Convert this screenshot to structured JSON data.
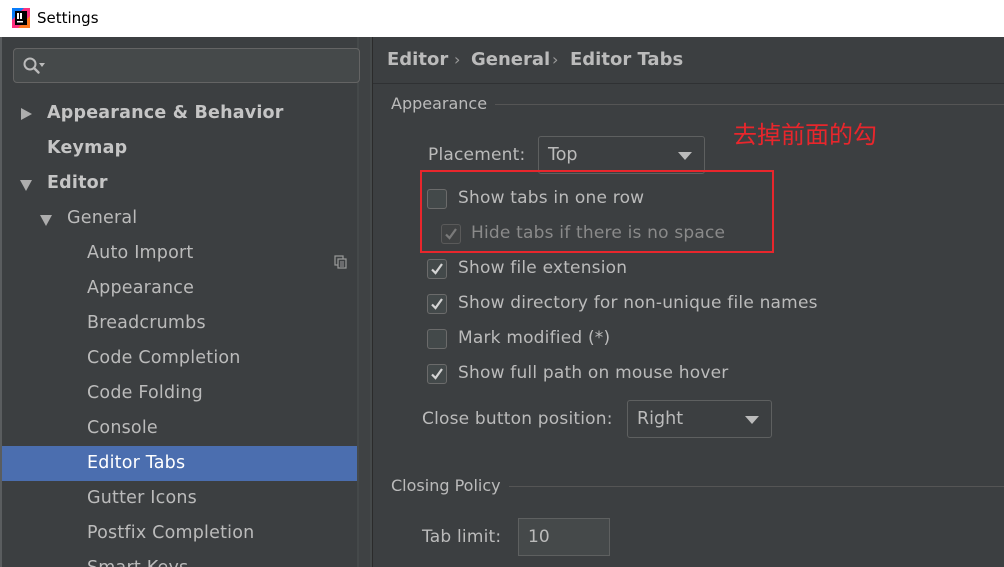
{
  "window": {
    "title": "Settings"
  },
  "search": {
    "placeholder": ""
  },
  "tree": [
    {
      "label": "Appearance & Behavior"
    },
    {
      "label": "Keymap"
    },
    {
      "label": "Editor"
    },
    {
      "label": "General"
    },
    {
      "label": "Auto Import"
    },
    {
      "label": "Appearance"
    },
    {
      "label": "Breadcrumbs"
    },
    {
      "label": "Code Completion"
    },
    {
      "label": "Code Folding"
    },
    {
      "label": "Console"
    },
    {
      "label": "Editor Tabs"
    },
    {
      "label": "Gutter Icons"
    },
    {
      "label": "Postfix Completion"
    },
    {
      "label": "Smart Keys"
    }
  ],
  "breadcrumb": {
    "items": [
      "Editor",
      "General",
      "Editor Tabs"
    ],
    "separator": "›"
  },
  "appearance_section": {
    "title": "Appearance",
    "placement_label": "Placement:",
    "placement_value": "Top",
    "options": [
      {
        "label": "Show tabs in one row",
        "checked": false,
        "enabled": true
      },
      {
        "label": "Hide tabs if there is no space",
        "checked": true,
        "enabled": false
      },
      {
        "label": "Show file extension",
        "checked": true,
        "enabled": true
      },
      {
        "label": "Show directory for non-unique file names",
        "checked": true,
        "enabled": true
      },
      {
        "label": "Mark modified (*)",
        "checked": false,
        "enabled": true
      },
      {
        "label": "Show full path on mouse hover",
        "checked": true,
        "enabled": true
      }
    ],
    "close_button_label": "Close button position:",
    "close_button_value": "Right"
  },
  "closing_section": {
    "title": "Closing Policy",
    "tab_limit_label": "Tab limit:",
    "tab_limit_value": "10"
  },
  "annotation": {
    "text": "去掉前面的勾",
    "color": "#e8262c"
  },
  "colors": {
    "background": "#3c3f41",
    "selection": "#4b6eaf",
    "text": "#bbbbbb"
  }
}
